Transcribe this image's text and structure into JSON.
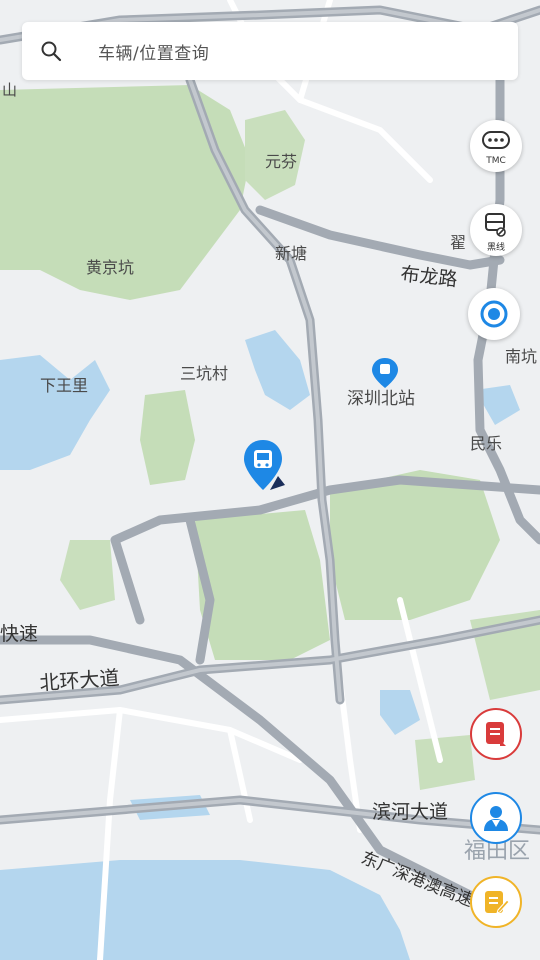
{
  "search": {
    "placeholder": "车辆/位置查询"
  },
  "controls": {
    "tmc_label": "TMC",
    "route_label": "黑线"
  },
  "map_labels": {
    "yuanfen": "元芬",
    "xintang": "新塘",
    "huangjingkeng": "黄京坑",
    "bulong_road": "布龙路",
    "sankengcun": "三坑村",
    "xiawangli": "下王里",
    "shenzhen_north": "深圳北站",
    "nankeng": "南坑",
    "minle": "民乐",
    "kuaisu": "快速",
    "beihuan": "北环大道",
    "binhe": "滨河大道",
    "futian": "福田区",
    "guangshen_expressway": "东广深港澳高速",
    "top_left_edge": "山",
    "top_right_edge": "翟"
  },
  "colors": {
    "land": "#eef0f2",
    "park": "#c5ddb8",
    "water": "#b4d6ee",
    "road": "#a3aab3",
    "accent_blue": "#1e88e5",
    "alarm_red": "#d93b3b",
    "note_yellow": "#f0b428"
  },
  "icons": {
    "search": "search-icon",
    "tmc": "traffic-chat-icon",
    "route": "vehicle-route-icon",
    "locate": "locate-icon",
    "vehicle": "bus-marker-icon",
    "station": "train-station-icon",
    "alarm": "alarm-list-icon",
    "driver": "driver-icon",
    "note": "note-edit-icon"
  }
}
